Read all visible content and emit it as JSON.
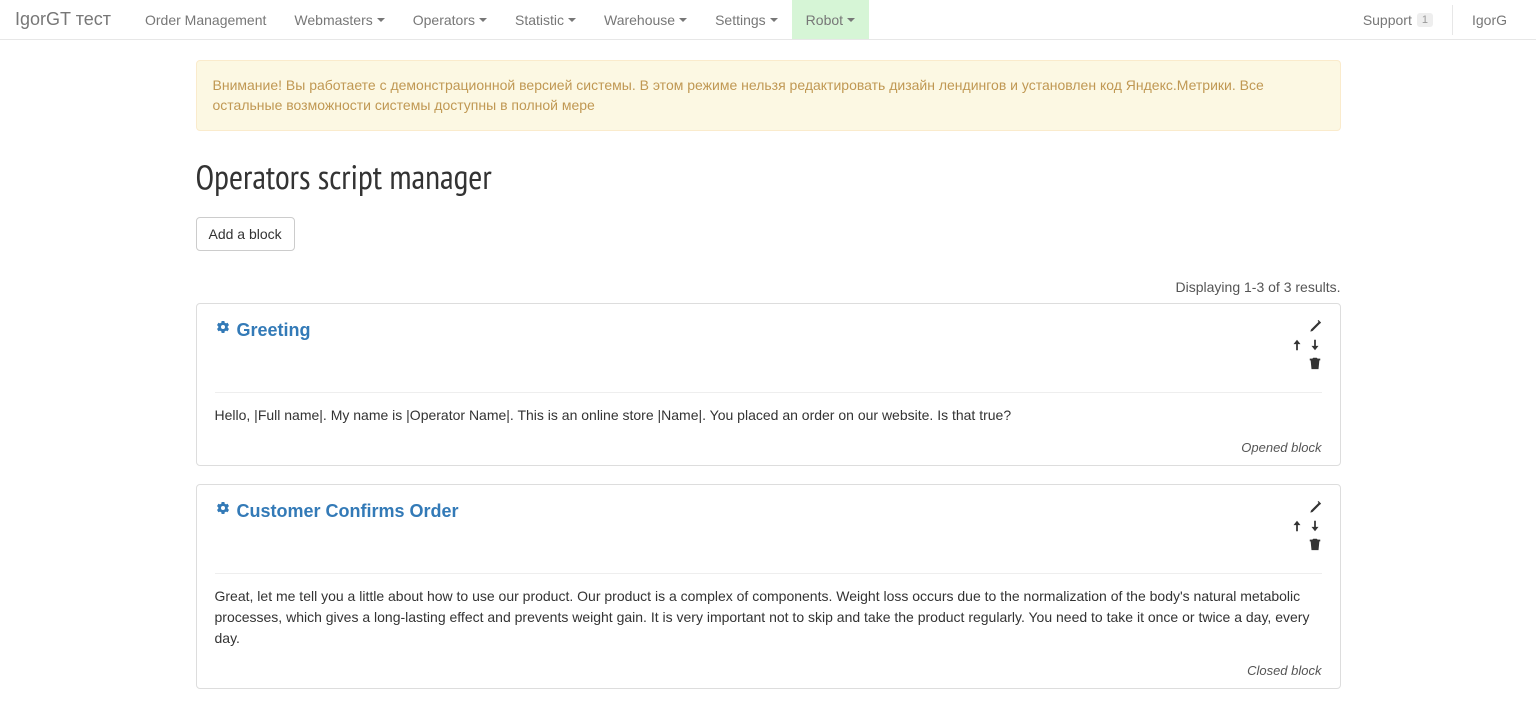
{
  "brand": "IgorGT тест",
  "nav": {
    "items": [
      {
        "label": "Order Management",
        "dropdown": false
      },
      {
        "label": "Webmasters",
        "dropdown": true
      },
      {
        "label": "Operators",
        "dropdown": true
      },
      {
        "label": "Statistic",
        "dropdown": true
      },
      {
        "label": "Warehouse",
        "dropdown": true
      },
      {
        "label": "Settings",
        "dropdown": true
      },
      {
        "label": "Robot",
        "dropdown": true,
        "active": true
      }
    ],
    "support": {
      "label": "Support",
      "badge": "1"
    },
    "user": "IgorG"
  },
  "alert": "Внимание! Вы работаете с демонстрационной версией системы. В этом режиме нельзя редактировать дизайн лендингов и установлен код Яндекс.Метрики. Все остальные возможности системы доступны в полной мере",
  "page_title": "Operators script manager",
  "add_block_label": "Add a block",
  "summary": "Displaying 1-3 of 3 results.",
  "blocks": [
    {
      "title": "Greeting",
      "body": "Hello, |Full name|. My name is |Operator Name|. This is an online store |Name|. You placed an order on our website. Is that true?",
      "status": "Opened block"
    },
    {
      "title": "Customer Confirms Order",
      "body": "Great, let me tell you a little about how to use our product. Our product is a complex of components. Weight loss occurs due to the normalization of the body's natural metabolic processes, which gives a long-lasting effect and prevents weight gain. It is very important not to skip and take the product regularly. You need to take it once or twice a day, every day.",
      "status": "Closed block"
    }
  ]
}
